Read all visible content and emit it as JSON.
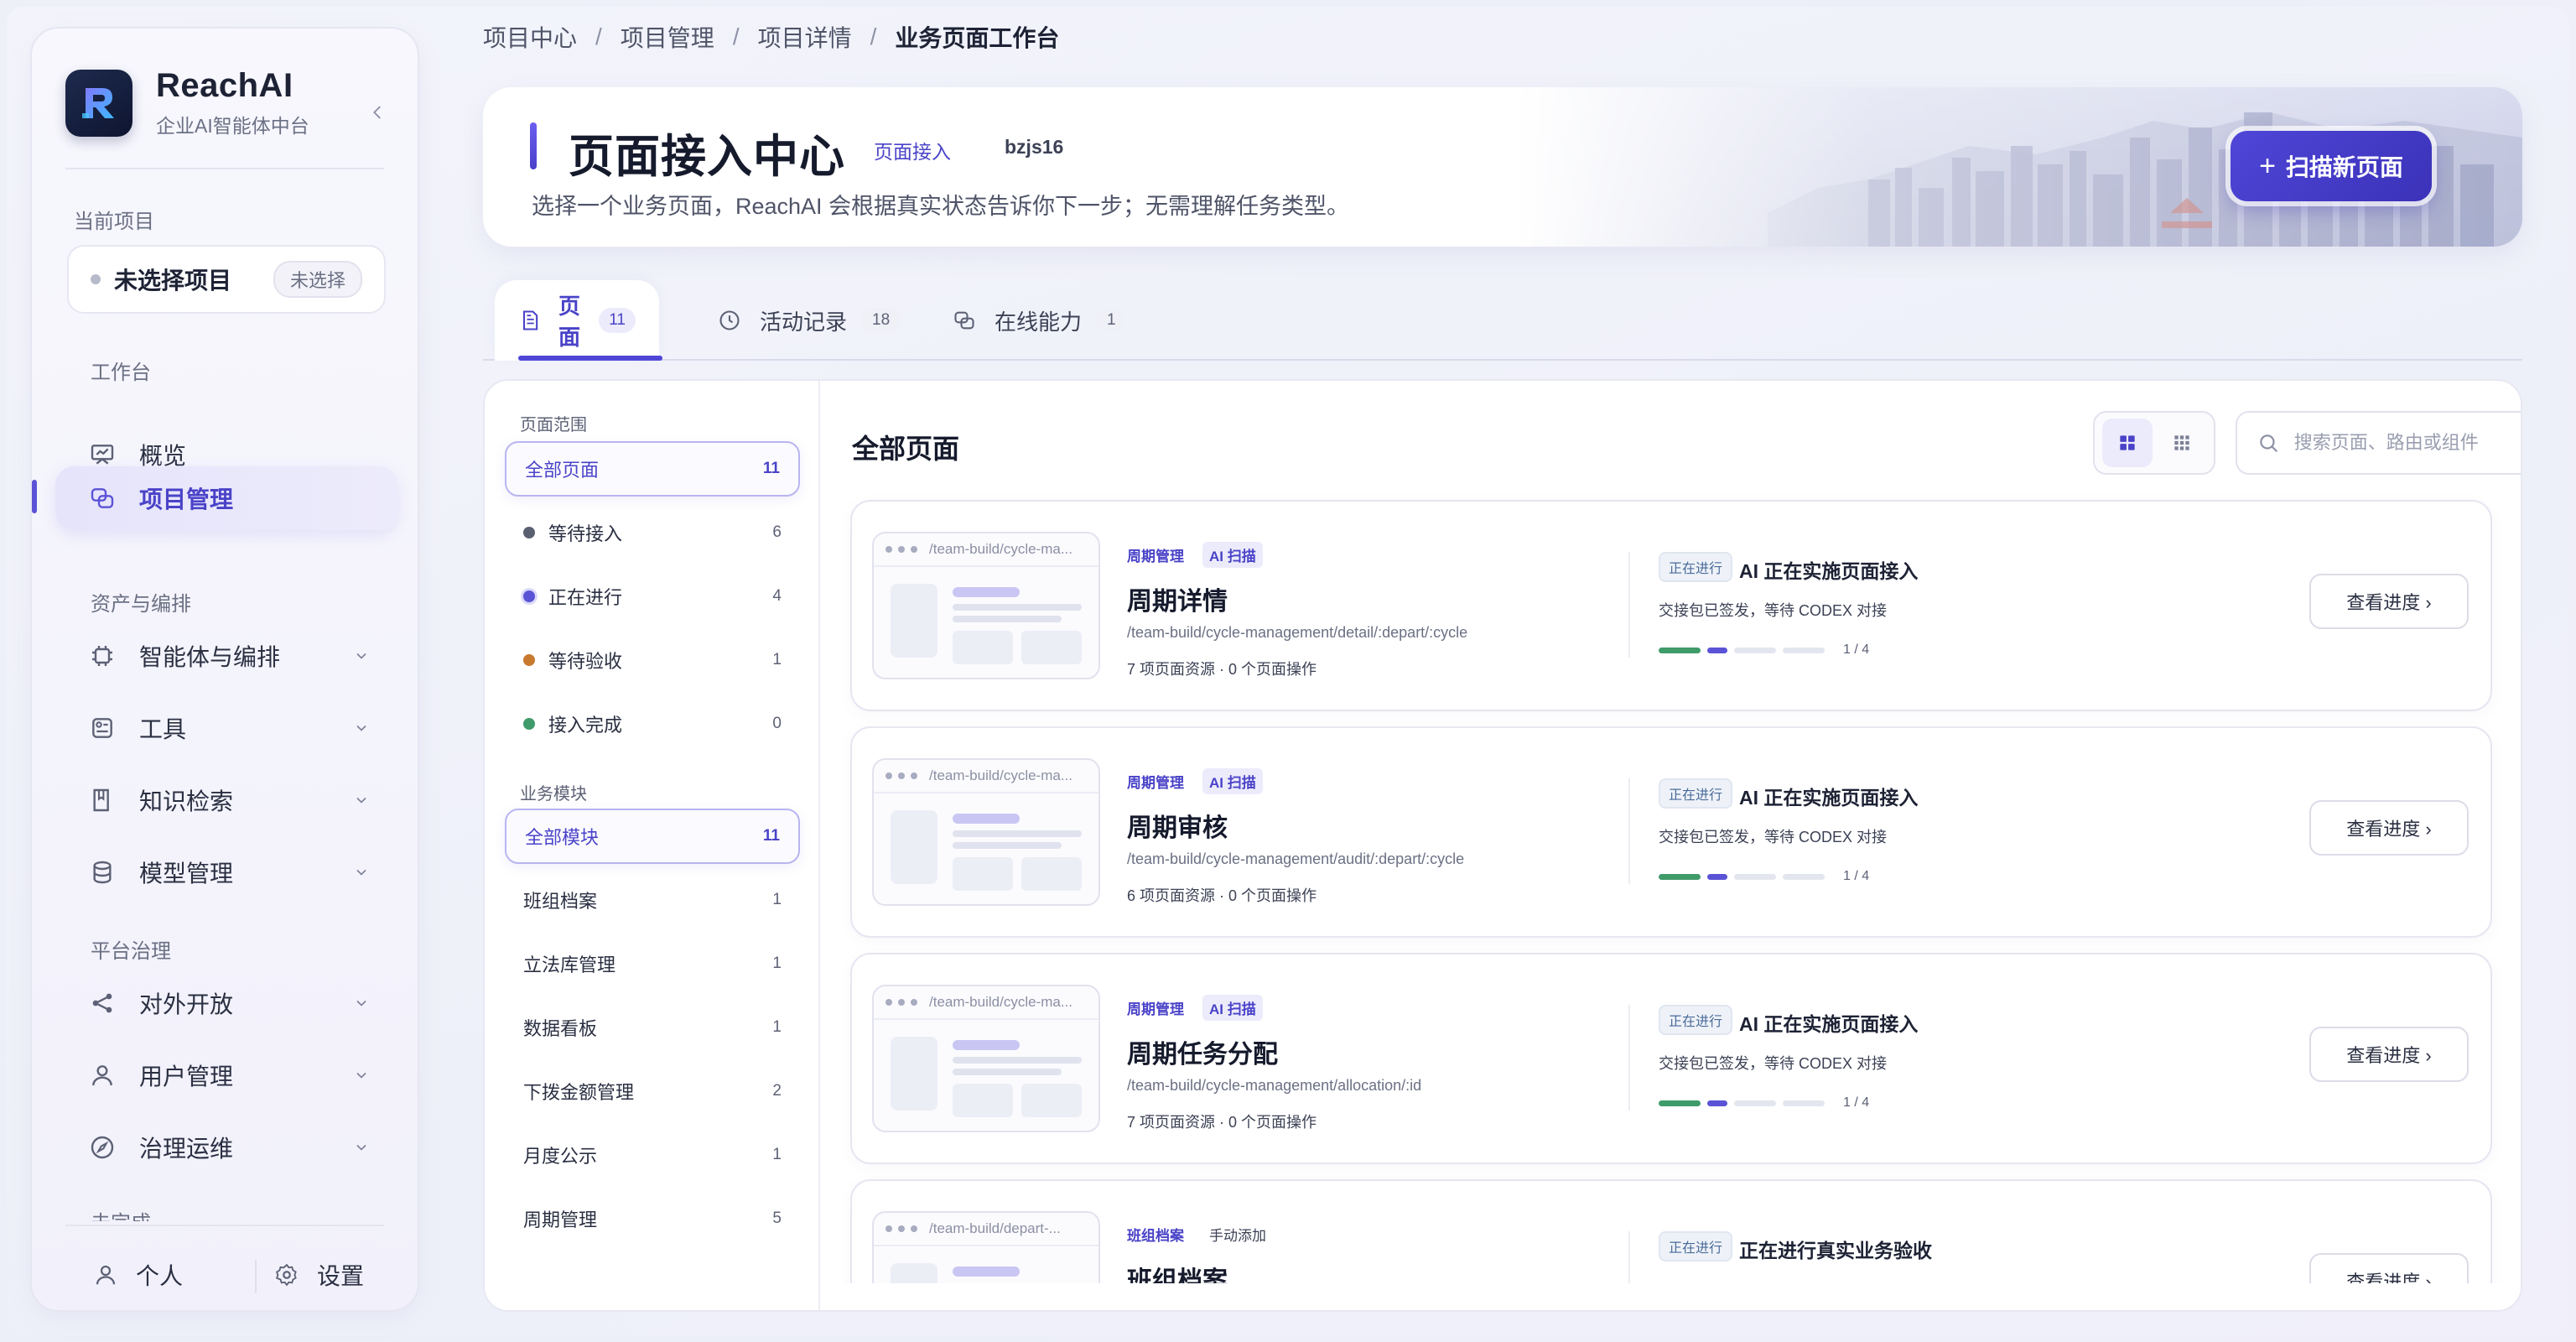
{
  "brand": {
    "name": "ReachAI",
    "subtitle": "企业AI智能体中台"
  },
  "sidebar": {
    "current_project_label": "当前项目",
    "project_name": "未选择项目",
    "project_badge": "未选择",
    "sections": {
      "workbench": "工作台",
      "assets": "资产与编排",
      "governance": "平台治理",
      "cut_off": "未完成"
    },
    "items": [
      {
        "label": "概览",
        "icon": "overview-icon",
        "active": false,
        "expandable": false
      },
      {
        "label": "项目管理",
        "icon": "project-icon",
        "active": true,
        "expandable": false
      },
      {
        "label": "智能体与编排",
        "icon": "chip-icon",
        "active": false,
        "expandable": true
      },
      {
        "label": "工具",
        "icon": "tool-icon",
        "active": false,
        "expandable": true
      },
      {
        "label": "知识检索",
        "icon": "book-icon",
        "active": false,
        "expandable": true
      },
      {
        "label": "模型管理",
        "icon": "database-icon",
        "active": false,
        "expandable": true
      },
      {
        "label": "对外开放",
        "icon": "share-icon",
        "active": false,
        "expandable": true
      },
      {
        "label": "用户管理",
        "icon": "user-icon",
        "active": false,
        "expandable": true
      },
      {
        "label": "治理运维",
        "icon": "compass-icon",
        "active": false,
        "expandable": true
      }
    ],
    "footer": {
      "profile": "个人",
      "settings": "设置"
    }
  },
  "breadcrumb": [
    "项目中心",
    "项目管理",
    "项目详情",
    "业务页面工作台"
  ],
  "hero": {
    "title": "页面接入中心",
    "tag": "页面接入",
    "code": "bzjs16",
    "description": "选择一个业务页面，ReachAI 会根据真实状态告诉你下一步；无需理解任务类型。",
    "scan_button": "扫描新页面"
  },
  "tabs": [
    {
      "label": "页面",
      "count": "11",
      "active": true
    },
    {
      "label": "活动记录",
      "count": "18",
      "active": false
    },
    {
      "label": "在线能力",
      "count": "1",
      "active": false
    }
  ],
  "filters": {
    "scope_heading": "页面范围",
    "scope": [
      {
        "label": "全部页面",
        "count": "11",
        "selected": true,
        "dot": ""
      },
      {
        "label": "等待接入",
        "count": "6",
        "selected": false,
        "dot": "#5a6072"
      },
      {
        "label": "正在进行",
        "count": "4",
        "selected": false,
        "dot": "#5b53d6"
      },
      {
        "label": "等待验收",
        "count": "1",
        "selected": false,
        "dot": "#c7792e"
      },
      {
        "label": "接入完成",
        "count": "0",
        "selected": false,
        "dot": "#3f9b6a"
      }
    ],
    "module_heading": "业务模块",
    "modules": [
      {
        "label": "全部模块",
        "count": "11",
        "selected": true
      },
      {
        "label": "班组档案",
        "count": "1",
        "selected": false
      },
      {
        "label": "立法库管理",
        "count": "1",
        "selected": false
      },
      {
        "label": "数据看板",
        "count": "1",
        "selected": false
      },
      {
        "label": "下拨金额管理",
        "count": "2",
        "selected": false
      },
      {
        "label": "月度公示",
        "count": "1",
        "selected": false
      },
      {
        "label": "周期管理",
        "count": "5",
        "selected": false
      }
    ]
  },
  "list": {
    "title": "全部页面",
    "search_placeholder": "搜索页面、路由或组件",
    "cards": [
      {
        "thumb_path": "/team-build/cycle-ma...",
        "module": "周期管理",
        "source": "AI 扫描",
        "title": "周期详情",
        "route": "/team-build/cycle-management/detail/:depart/:cycle",
        "meta": "7 项页面资源 · 0 个页面操作",
        "status_badge": "正在进行",
        "status_title": "AI 正在实施页面接入",
        "status_desc": "交接包已签发，等待 CODEX 对接",
        "progress": "1 / 4",
        "button": "查看进度 ›"
      },
      {
        "thumb_path": "/team-build/cycle-ma...",
        "module": "周期管理",
        "source": "AI 扫描",
        "title": "周期审核",
        "route": "/team-build/cycle-management/audit/:depart/:cycle",
        "meta": "6 项页面资源 · 0 个页面操作",
        "status_badge": "正在进行",
        "status_title": "AI 正在实施页面接入",
        "status_desc": "交接包已签发，等待 CODEX 对接",
        "progress": "1 / 4",
        "button": "查看进度 ›"
      },
      {
        "thumb_path": "/team-build/cycle-ma...",
        "module": "周期管理",
        "source": "AI 扫描",
        "title": "周期任务分配",
        "route": "/team-build/cycle-management/allocation/:id",
        "meta": "7 项页面资源 · 0 个页面操作",
        "status_badge": "正在进行",
        "status_title": "AI 正在实施页面接入",
        "status_desc": "交接包已签发，等待 CODEX 对接",
        "progress": "1 / 4",
        "button": "查看进度 ›"
      },
      {
        "thumb_path": "/team-build/depart-...",
        "module": "班组档案",
        "source": "手动添加",
        "title": "班组档案",
        "route": "",
        "meta": "",
        "status_badge": "正在进行",
        "status_title": "正在进行真实业务验收",
        "status_desc": "",
        "progress": "",
        "button": "查看进度 ›"
      }
    ]
  },
  "colors": {
    "accent": "#4f46d8",
    "accent_dark": "#3b32b8",
    "success": "#3f9b6a",
    "warning": "#c7792e"
  }
}
